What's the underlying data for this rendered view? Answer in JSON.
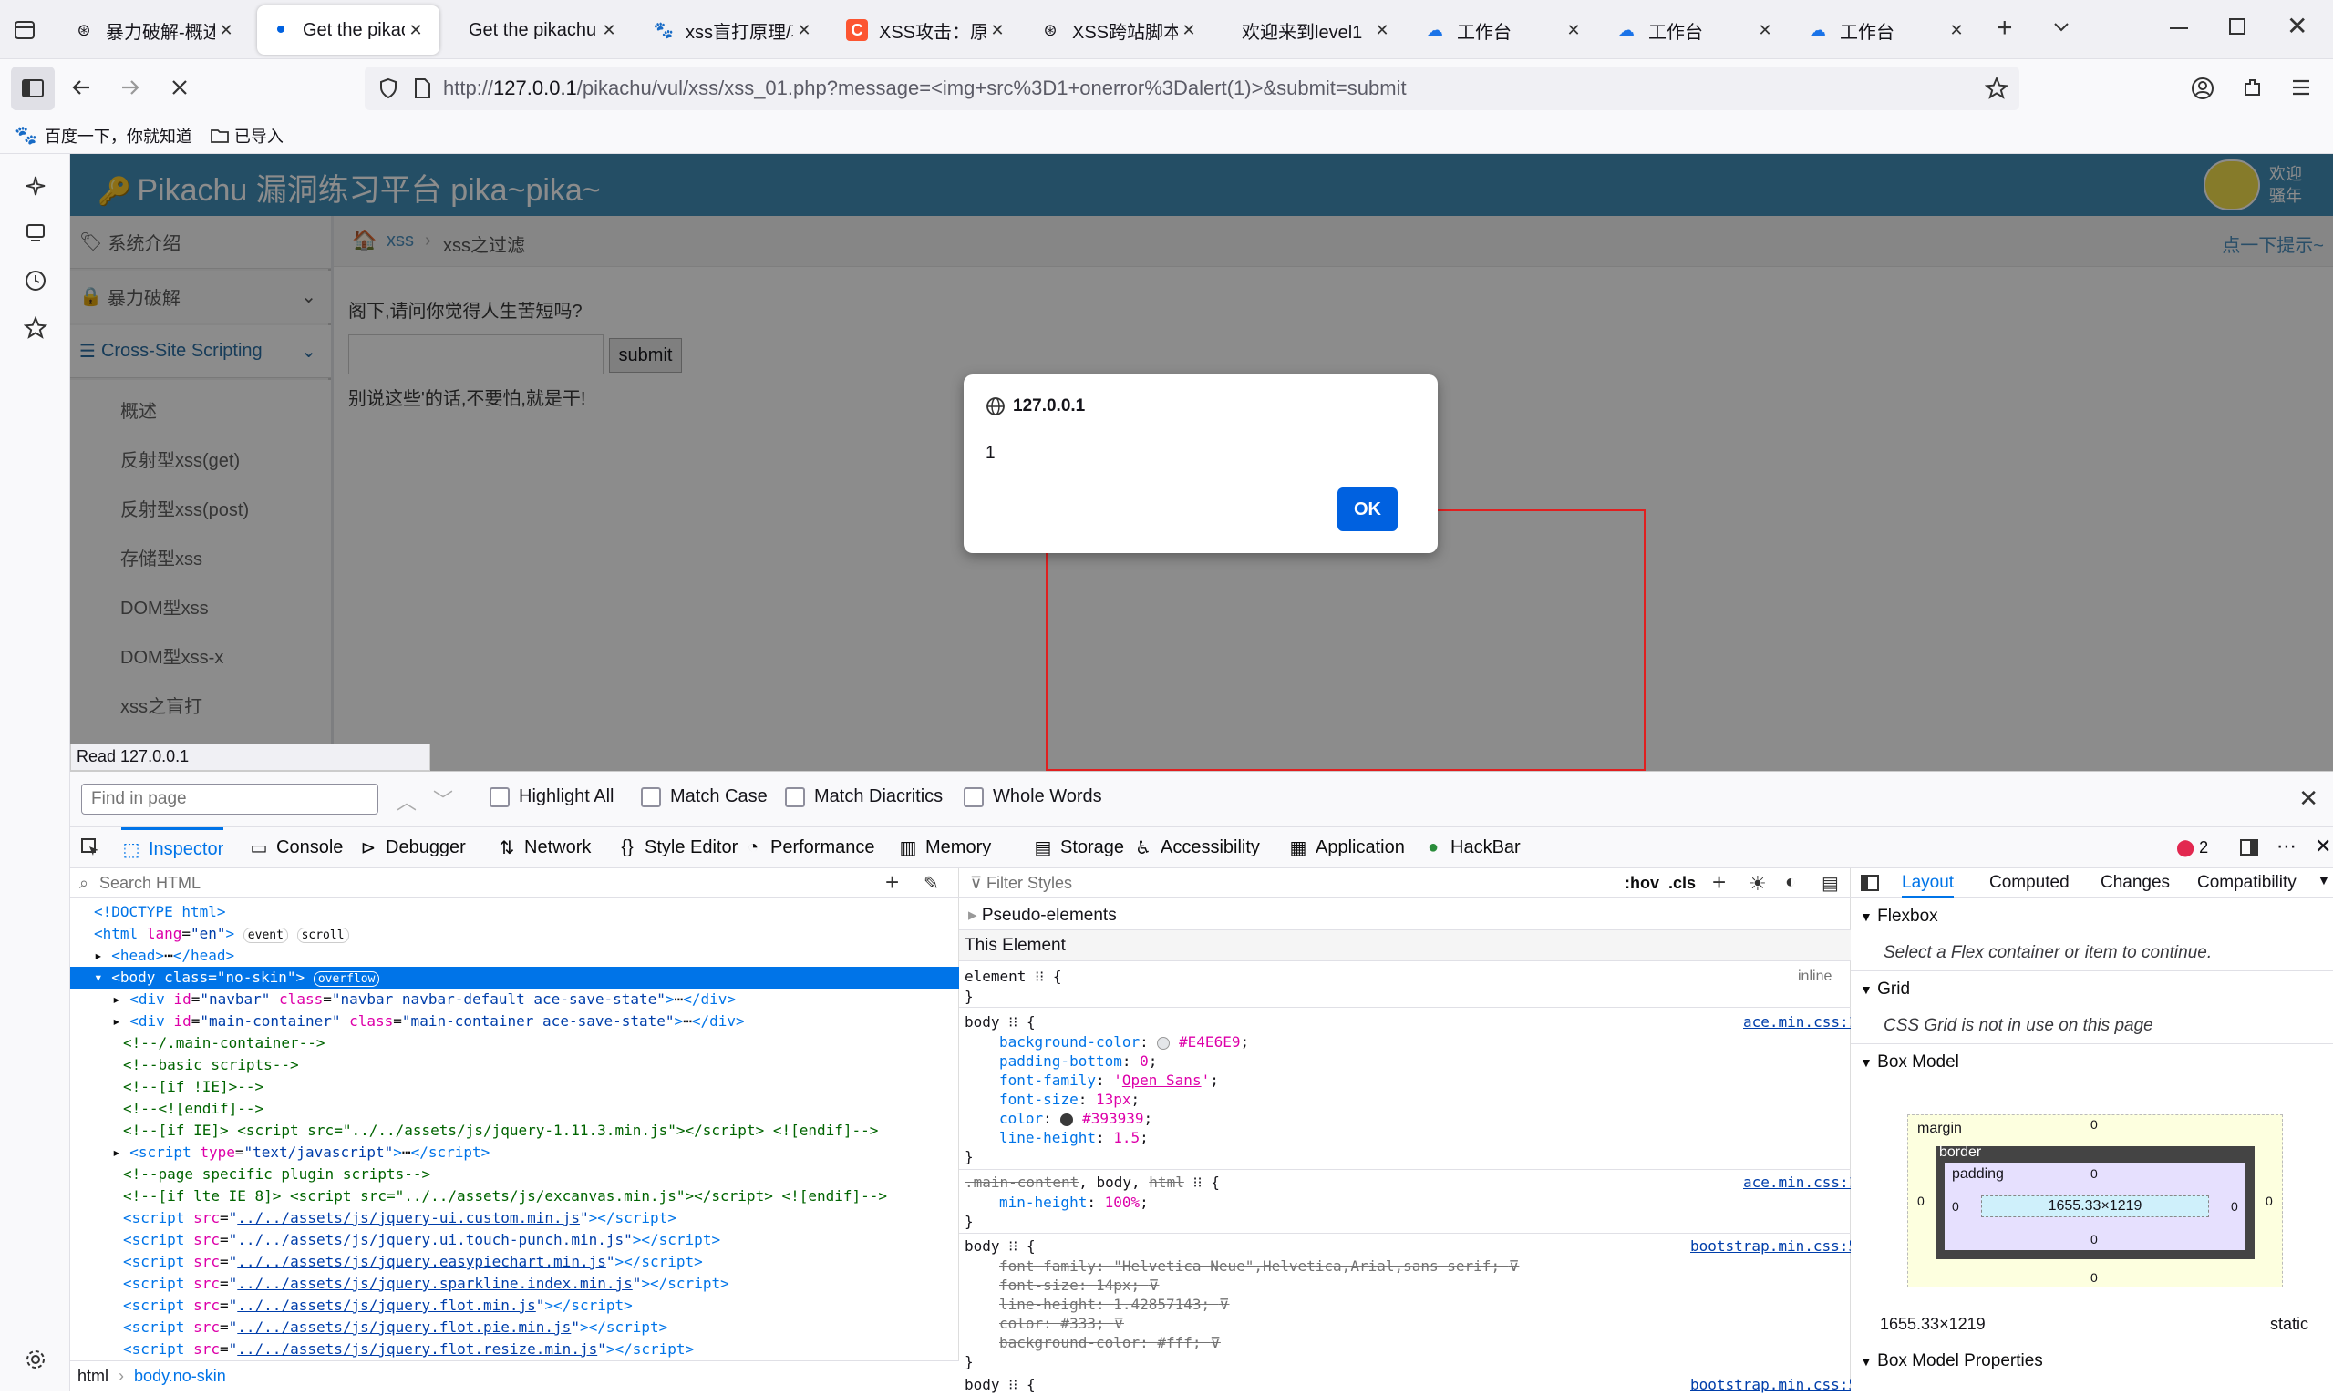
{
  "tabs": [
    {
      "title": "暴力破解-概述",
      "icon": "fingerprint-icon"
    },
    {
      "title": "Get the pikachu",
      "icon": "loading-dot-icon",
      "active": true
    },
    {
      "title": "Get the pikachu",
      "icon": ""
    },
    {
      "title": "xss盲打原理/攻",
      "icon": "paw-icon"
    },
    {
      "title": "XSS攻击：原理",
      "icon": "csdn-icon"
    },
    {
      "title": "XSS跨站脚本-D",
      "icon": "fingerprint-icon"
    },
    {
      "title": "欢迎来到level1",
      "icon": ""
    },
    {
      "title": "工作台",
      "icon": "cloud-icon"
    },
    {
      "title": "工作台",
      "icon": "cloud-icon"
    },
    {
      "title": "工作台",
      "icon": "cloud-icon"
    }
  ],
  "url": {
    "scheme": "http://",
    "host": "127.0.0.1",
    "path": "/pikachu/vul/xss/xss_01.php?message=<img+src%3D1+onerror%3Dalert(1)>&submit=submit"
  },
  "bookmarks": [
    "百度一下，你就知道",
    "已导入"
  ],
  "pikachu": {
    "title": "Pikachu 漏洞练习平台 pika~pika~",
    "welcome": [
      "欢迎",
      "骚年"
    ],
    "menu": [
      {
        "label": "系统介绍",
        "icon": "tag-icon"
      },
      {
        "label": "暴力破解",
        "icon": "lock-icon"
      },
      {
        "label": "Cross-Site Scripting",
        "icon": "list-icon"
      }
    ],
    "submenu": [
      "概述",
      "反射型xss(get)",
      "反射型xss(post)",
      "存储型xss",
      "DOM型xss",
      "DOM型xss-x",
      "xss之盲打",
      "xss之过滤"
    ],
    "breadcrumb": [
      "xss",
      "xss之过滤"
    ],
    "hint": "点一下提示~",
    "question": "阁下,请问你觉得人生苦短吗?",
    "submit": "submit",
    "message": "别说这些'的话,不要怕,就是干!"
  },
  "alert": {
    "origin": "127.0.0.1",
    "message": "1",
    "ok": "OK"
  },
  "status": "Read 127.0.0.1",
  "findbar": {
    "placeholder": "Find in page",
    "options": [
      "Highlight All",
      "Match Case",
      "Match Diacritics",
      "Whole Words"
    ]
  },
  "devtools": {
    "tabs": [
      {
        "label": "Inspector",
        "icon": "inspector-icon"
      },
      {
        "label": "Console",
        "icon": "console-icon"
      },
      {
        "label": "Debugger",
        "icon": "debugger-icon"
      },
      {
        "label": "Network",
        "icon": "network-icon"
      },
      {
        "label": "Style Editor",
        "icon": "braces-icon"
      },
      {
        "label": "Performance",
        "icon": "gauge-icon"
      },
      {
        "label": "Memory",
        "icon": "memory-icon"
      },
      {
        "label": "Storage",
        "icon": "storage-icon"
      },
      {
        "label": "Accessibility",
        "icon": "accessibility-icon"
      },
      {
        "label": "Application",
        "icon": "grid-icon"
      },
      {
        "label": "HackBar",
        "icon": "hackbar-icon"
      }
    ],
    "error_count": "2",
    "search_html": "Search HTML",
    "filter_styles": "Filter Styles",
    "hov": ":hov",
    "cls": ".cls",
    "breadcrumb": [
      "html",
      "body.no-skin"
    ],
    "layout_tabs": [
      "Layout",
      "Computed",
      "Changes",
      "Compatibility"
    ],
    "flexbox": "Flexbox",
    "flexbox_msg": "Select a Flex container or item to continue.",
    "grid": "Grid",
    "grid_msg": "CSS Grid is not in use on this page",
    "box_model": "Box Model",
    "box_size": "1655.33×1219",
    "position": "static",
    "box_props": "Box Model Properties",
    "box_labels": {
      "margin": "margin",
      "border": "border",
      "padding": "padding"
    },
    "pseudo": "Pseudo-elements",
    "this_element": "This Element",
    "inline": "inline"
  }
}
